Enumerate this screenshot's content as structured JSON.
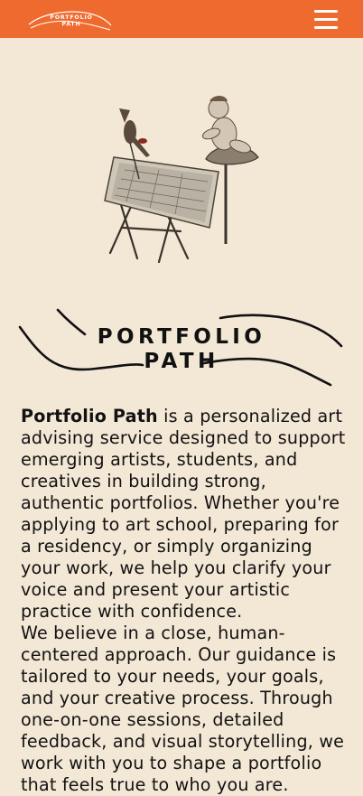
{
  "header": {
    "logo_line1": "PORTFOLIO",
    "logo_line2": "PATH",
    "menu_icon": "hamburger-menu-icon",
    "bg_color": "#ef6a2e"
  },
  "hero": {
    "illustration": "vintage-collage-child-drawing-board-illustration"
  },
  "brand_logo": {
    "line1": "PORTFOLIO",
    "line2": "PATH"
  },
  "intro": {
    "brand_name": "Portfolio Path",
    "paragraph1_rest": " is a personalized art advising service designed to support emerging artists, students, and creatives in building strong, authentic portfolios. Whether you're applying to art school, preparing for a residency, or simply organizing your work, we help you clarify your voice and present your artistic practice with confidence.",
    "paragraph2": "We believe in a close, human-centered approach. Our guidance is tailored to your needs, your goals, and your creative process. Through one-on-one sessions, detailed feedback, and visual storytelling, we work with you to shape a portfolio that feels true to who you are."
  },
  "colors": {
    "background": "#f3e7d5",
    "accent": "#ef6a2e",
    "text": "#121212"
  }
}
